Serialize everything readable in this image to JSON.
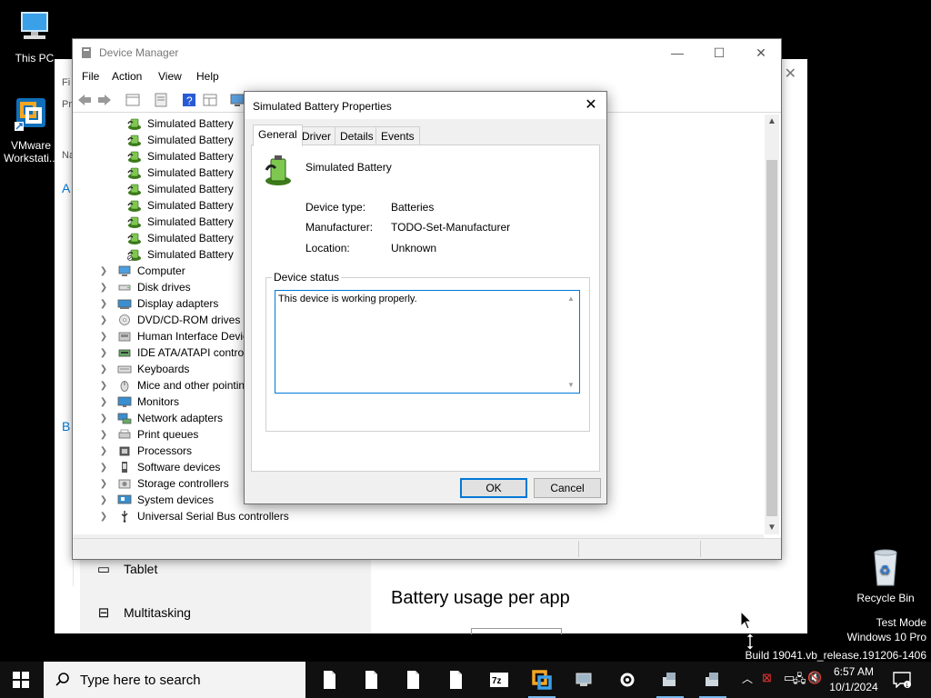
{
  "desktop": {
    "icons": [
      {
        "label": "This PC"
      },
      {
        "label": "VMware Workstati..."
      },
      {
        "label": "Recycle Bin"
      }
    ],
    "watermark": {
      "line1": "Test Mode",
      "line2": "Windows 10 Pro",
      "line3": "Build 19041.vb_release.191206-1406"
    }
  },
  "settings_window": {
    "items": [
      {
        "label": "Tablet",
        "icon": "tablet-icon"
      },
      {
        "label": "Multitasking",
        "icon": "multitasking-icon"
      }
    ],
    "heading": "Battery usage per app",
    "left_letters": [
      "Fi",
      "Pr",
      "Na",
      "A",
      "B"
    ]
  },
  "device_manager": {
    "title": "Device Manager",
    "menu": [
      "File",
      "Action",
      "View",
      "Help"
    ],
    "battery_items": [
      "Simulated Battery",
      "Simulated Battery",
      "Simulated Battery",
      "Simulated Battery",
      "Simulated Battery",
      "Simulated Battery",
      "Simulated Battery",
      "Simulated Battery",
      "Simulated Battery"
    ],
    "categories": [
      {
        "label": "Computer",
        "icon": "computer-icon"
      },
      {
        "label": "Disk drives",
        "icon": "disk-drive-icon"
      },
      {
        "label": "Display adapters",
        "icon": "display-adapter-icon"
      },
      {
        "label": "DVD/CD-ROM drives",
        "icon": "dvd-icon"
      },
      {
        "label": "Human Interface Device",
        "icon": "hid-icon"
      },
      {
        "label": "IDE ATA/ATAPI controlle",
        "icon": "ide-icon"
      },
      {
        "label": "Keyboards",
        "icon": "keyboard-icon"
      },
      {
        "label": "Mice and other pointing",
        "icon": "mouse-icon"
      },
      {
        "label": "Monitors",
        "icon": "monitor-icon"
      },
      {
        "label": "Network adapters",
        "icon": "network-icon"
      },
      {
        "label": "Print queues",
        "icon": "printer-icon"
      },
      {
        "label": "Processors",
        "icon": "processor-icon"
      },
      {
        "label": "Software devices",
        "icon": "software-device-icon"
      },
      {
        "label": "Storage controllers",
        "icon": "storage-icon"
      },
      {
        "label": "System devices",
        "icon": "system-device-icon"
      },
      {
        "label": "Universal Serial Bus controllers",
        "icon": "usb-icon"
      }
    ]
  },
  "dialog": {
    "title": "Simulated Battery Properties",
    "tabs": [
      "General",
      "Driver",
      "Details",
      "Events"
    ],
    "active_tab": "General",
    "device_name": "Simulated Battery",
    "props": [
      {
        "label": "Device type:",
        "value": "Batteries"
      },
      {
        "label": "Manufacturer:",
        "value": "TODO-Set-Manufacturer"
      },
      {
        "label": "Location:",
        "value": "Unknown"
      }
    ],
    "status_group_label": "Device status",
    "status_text": "This device is working properly.",
    "ok_label": "OK",
    "cancel_label": "Cancel"
  },
  "taskbar": {
    "search_placeholder": "Type here to search",
    "time": "6:57 AM",
    "date": "10/1/2024",
    "pinned": [
      "file-icon",
      "file-icon",
      "file-icon",
      "file-icon",
      "7zip-icon",
      "vmware-icon",
      "remote-desktop-icon",
      "settings-gear-icon",
      "device-icon",
      "device-icon"
    ]
  },
  "colors": {
    "accent": "#0078d7",
    "taskbar": "#101010",
    "desktop": "#000000"
  }
}
